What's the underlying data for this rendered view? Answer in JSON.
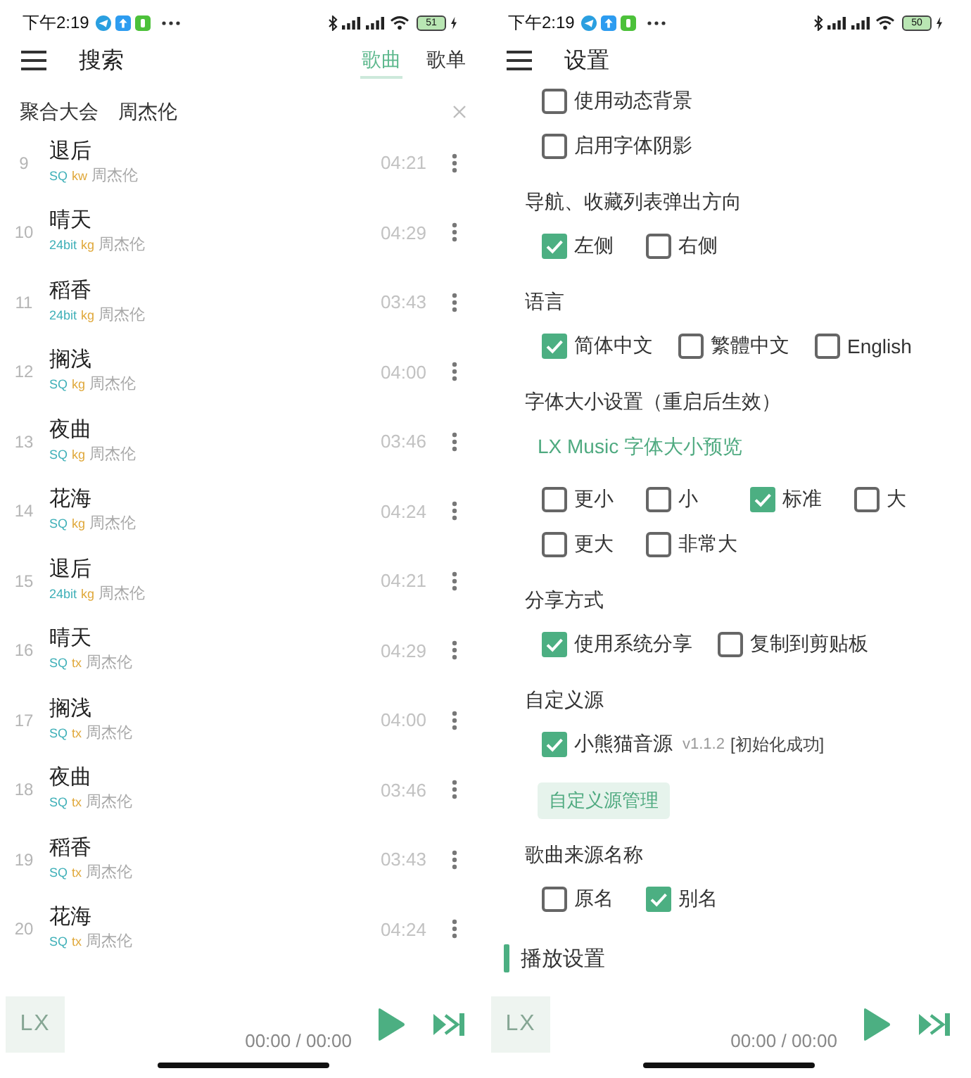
{
  "screens": [
    {
      "kind": "search",
      "status_bar": {
        "time": "下午2:19",
        "battery": "51"
      },
      "header": {
        "title": "搜索",
        "tabs": [
          {
            "label": "歌曲",
            "selected": true
          },
          {
            "label": "歌单",
            "selected": false
          }
        ]
      },
      "search": {
        "source": "聚合大会",
        "query": "周杰伦"
      },
      "songs": [
        {
          "number": "9",
          "title": "退后",
          "quality": "SQ",
          "source": "kw",
          "artist": "周杰伦",
          "duration": "04:21"
        },
        {
          "number": "10",
          "title": "晴天",
          "quality": "24bit",
          "source": "kg",
          "artist": "周杰伦",
          "duration": "04:29"
        },
        {
          "number": "11",
          "title": "稻香",
          "quality": "24bit",
          "source": "kg",
          "artist": "周杰伦",
          "duration": "03:43"
        },
        {
          "number": "12",
          "title": "搁浅",
          "quality": "SQ",
          "source": "kg",
          "artist": "周杰伦",
          "duration": "04:00"
        },
        {
          "number": "13",
          "title": "夜曲",
          "quality": "SQ",
          "source": "kg",
          "artist": "周杰伦",
          "duration": "03:46"
        },
        {
          "number": "14",
          "title": "花海",
          "quality": "SQ",
          "source": "kg",
          "artist": "周杰伦",
          "duration": "04:24"
        },
        {
          "number": "15",
          "title": "退后",
          "quality": "24bit",
          "source": "kg",
          "artist": "周杰伦",
          "duration": "04:21"
        },
        {
          "number": "16",
          "title": "晴天",
          "quality": "SQ",
          "source": "tx",
          "artist": "周杰伦",
          "duration": "04:29"
        },
        {
          "number": "17",
          "title": "搁浅",
          "quality": "SQ",
          "source": "tx",
          "artist": "周杰伦",
          "duration": "04:00"
        },
        {
          "number": "18",
          "title": "夜曲",
          "quality": "SQ",
          "source": "tx",
          "artist": "周杰伦",
          "duration": "03:46"
        },
        {
          "number": "19",
          "title": "稻香",
          "quality": "SQ",
          "source": "tx",
          "artist": "周杰伦",
          "duration": "03:43"
        },
        {
          "number": "20",
          "title": "花海",
          "quality": "SQ",
          "source": "tx",
          "artist": "周杰伦",
          "duration": "04:24"
        }
      ],
      "player": {
        "logo": "LX",
        "time": "00:00 / 00:00"
      }
    },
    {
      "kind": "settings",
      "status_bar": {
        "time": "下午2:19",
        "battery": "50"
      },
      "header": {
        "title": "设置"
      },
      "items": [
        {
          "kind": "options",
          "options": [
            {
              "label": "使用动态背景",
              "checked": false
            }
          ]
        },
        {
          "kind": "options",
          "options": [
            {
              "label": "启用字体阴影",
              "checked": false
            }
          ]
        },
        {
          "kind": "heading",
          "text": "导航、收藏列表弹出方向"
        },
        {
          "kind": "options",
          "options": [
            {
              "label": "左侧",
              "checked": true
            },
            {
              "label": "右侧",
              "checked": false
            }
          ]
        },
        {
          "kind": "heading",
          "text": "语言"
        },
        {
          "kind": "options",
          "options": [
            {
              "label": "简体中文",
              "checked": true
            },
            {
              "label": "繁體中文",
              "checked": false
            },
            {
              "label": "English",
              "checked": false
            }
          ]
        },
        {
          "kind": "heading",
          "text": "字体大小设置（重启后生效）"
        },
        {
          "kind": "preview",
          "text": "LX Music 字体大小预览"
        },
        {
          "kind": "options",
          "options": [
            {
              "label": "更小",
              "checked": false
            },
            {
              "label": "小",
              "checked": false
            },
            {
              "label": "标准",
              "checked": true
            },
            {
              "label": "大",
              "checked": false
            }
          ]
        },
        {
          "kind": "options",
          "options": [
            {
              "label": "更大",
              "checked": false
            },
            {
              "label": "非常大",
              "checked": false
            }
          ]
        },
        {
          "kind": "heading",
          "text": "分享方式"
        },
        {
          "kind": "options",
          "options": [
            {
              "label": "使用系统分享",
              "checked": true
            },
            {
              "label": "复制到剪贴板",
              "checked": false
            }
          ]
        },
        {
          "kind": "heading",
          "text": "自定义源"
        },
        {
          "kind": "options",
          "options": [
            {
              "label": "小熊猫音源",
              "checked": true,
              "version": "v1.1.2",
              "status": "[初始化成功]"
            }
          ]
        },
        {
          "kind": "button",
          "label": "自定义源管理"
        },
        {
          "kind": "heading",
          "text": "歌曲来源名称"
        },
        {
          "kind": "options",
          "options": [
            {
              "label": "原名",
              "checked": false
            },
            {
              "label": "别名",
              "checked": true
            }
          ]
        },
        {
          "kind": "section",
          "text": "播放设置"
        }
      ],
      "player": {
        "logo": "LX",
        "time": "00:00 / 00:00"
      }
    }
  ]
}
